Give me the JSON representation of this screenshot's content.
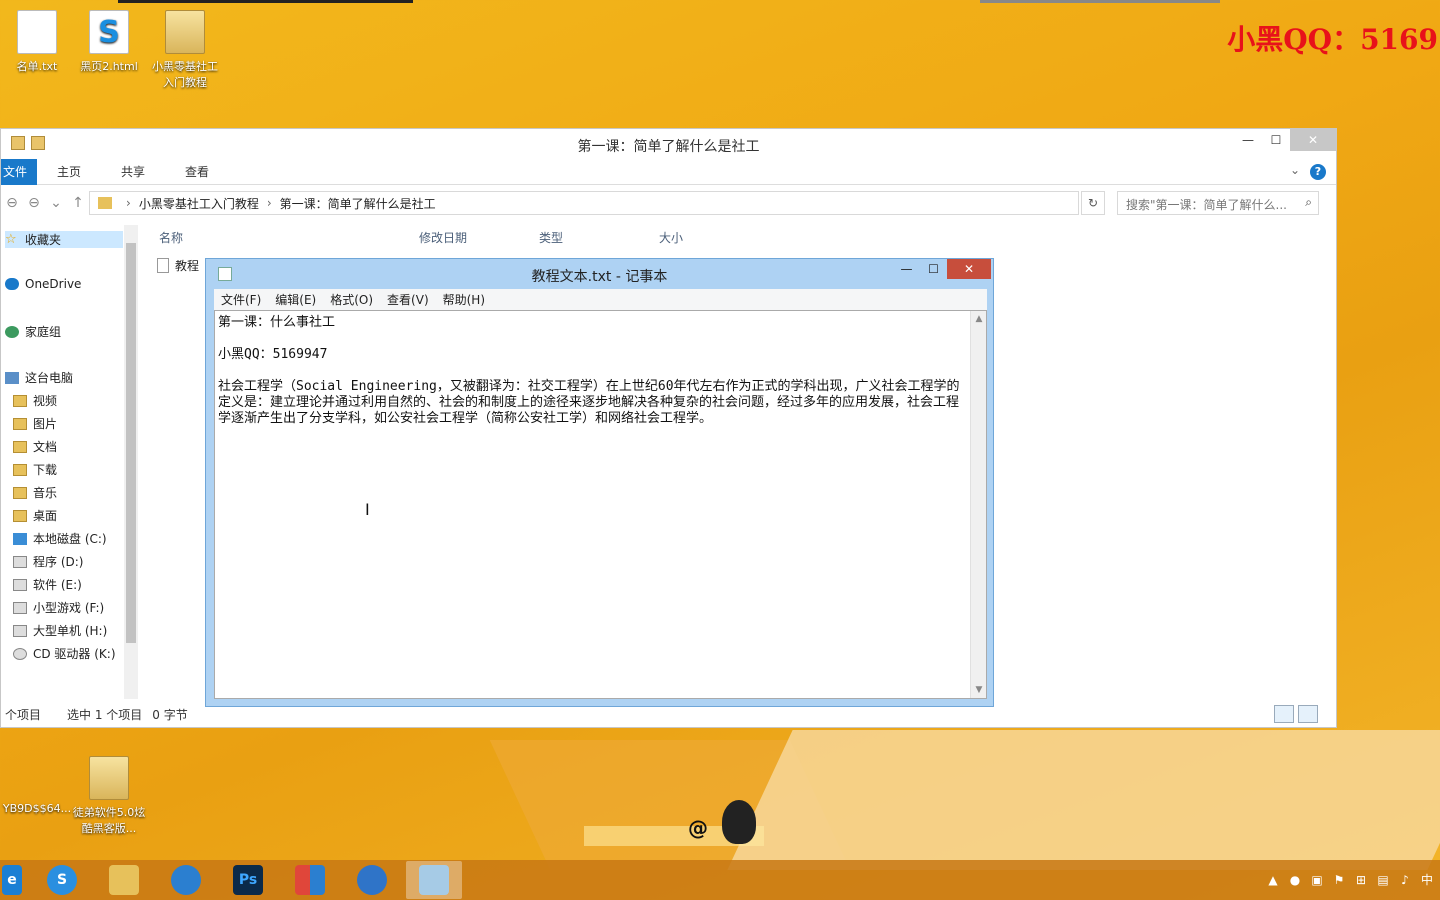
{
  "watermark": "小黑QQ：5169",
  "desktop_icons": [
    {
      "label": "名单.txt",
      "icon": "text-file-icon"
    },
    {
      "label": "黑页2.html",
      "icon": "html-file-icon"
    },
    {
      "label": "小黑零基社工入门教程",
      "icon": "folder-icon"
    },
    {
      "label": "YB9D$$64...",
      "icon": "file-icon"
    },
    {
      "label": "徒弟软件5.0炫酷黑客版...",
      "icon": "folder-icon"
    }
  ],
  "explorer": {
    "title": "第一课：简单了解什么是社工",
    "ribbon_tabs": [
      "文件",
      "主页",
      "共享",
      "查看"
    ],
    "breadcrumb": [
      "小黑零基社工入门教程",
      "第一课：简单了解什么是社工"
    ],
    "search_placeholder": "搜索\"第一课：简单了解什么...",
    "nav": {
      "favorites": "收藏夹",
      "onedrive": "OneDrive",
      "homegroup": "家庭组",
      "this_pc": "这台电脑",
      "items": [
        "视频",
        "图片",
        "文档",
        "下载",
        "音乐",
        "桌面",
        "本地磁盘 (C:)",
        "程序 (D:)",
        "软件 (E:)",
        "小型游戏 (F:)",
        "大型单机 (H:)",
        "CD 驱动器 (K:)"
      ]
    },
    "columns": [
      "名称",
      "修改日期",
      "类型",
      "大小"
    ],
    "file_name": "教程",
    "status": {
      "count": "个项目",
      "selected": "选中 1 个项目",
      "size": "0 字节"
    }
  },
  "notepad": {
    "title": "教程文本.txt - 记事本",
    "menu": [
      "文件(F)",
      "编辑(E)",
      "格式(O)",
      "查看(V)",
      "帮助(H)"
    ],
    "content": "第一课：什么事社工\n\n小黑QQ：5169947\n\n社会工程学（Social Engineering，又被翻译为：社交工程学）在上世纪60年代左右作为正式的学科出现，广义社会工程学的定义是：建立理论并通过利用自然的、社会的和制度上的途径来逐步地解决各种复杂的社会问题，经过多年的应用发展，社会工程学逐渐产生出了分支学科，如公安社会工程学（简称公安社工学）和网络社会工程学。"
  },
  "taskbar": {
    "items": [
      "ie-icon",
      "sogou-icon",
      "file-explorer-icon",
      "qq-browser-icon",
      "photoshop-icon",
      "app-icon",
      "globe-icon",
      "notepad-icon"
    ],
    "ps_label": "Ps",
    "tray_ime": "中"
  },
  "colors": {
    "accent": "#1979ca",
    "watermark": "#e8121a",
    "notepad_frame": "#aed2f3",
    "close": "#c74e3c"
  }
}
